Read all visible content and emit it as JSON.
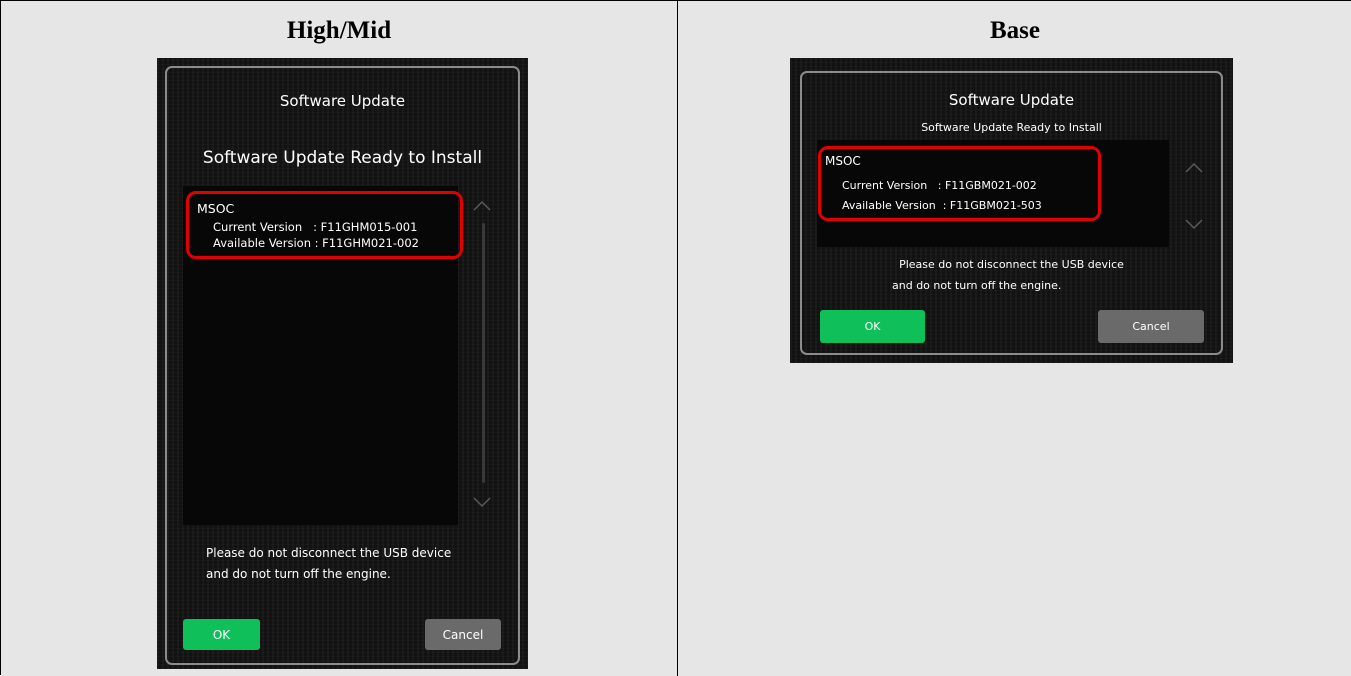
{
  "columns": {
    "left_heading": "High/Mid",
    "right_heading": "Base"
  },
  "high_mid": {
    "title": "Software Update",
    "subtitle": "Software Update Ready to Install",
    "module": "MSOC",
    "current_version": "Current Version   : F11GHM015-001",
    "available_version": "Available Version : F11GHM021-002",
    "notice_line1": "Please do not disconnect the USB device",
    "notice_line2": "and do not turn off the engine.",
    "ok_label": "OK",
    "cancel_label": "Cancel"
  },
  "base": {
    "title": "Software Update",
    "subtitle": "Software Update Ready to Install",
    "module": "MSOC",
    "current_version": "Current Version   : F11GBM021-002",
    "available_version": "Available Version  : F11GBM021-503",
    "notice_line1": "Please do not disconnect the USB device",
    "notice_line2": "and do not turn off the engine.",
    "ok_label": "OK",
    "cancel_label": "Cancel"
  },
  "colors": {
    "highlight": "#e00000",
    "ok_button": "#0fbf5a",
    "cancel_button": "#6a6a6a",
    "screen_bg": "#121212"
  }
}
